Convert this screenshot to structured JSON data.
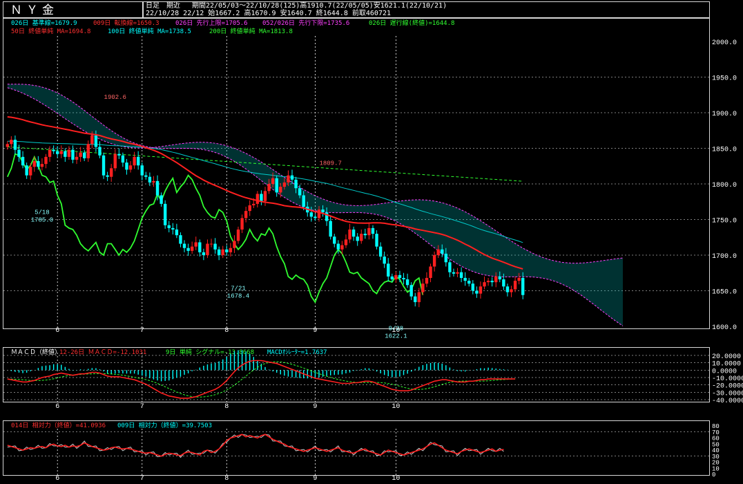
{
  "header": {
    "title": "ＮＹ金",
    "period_type": "日足　期近",
    "range_info": "期間22/05/03～22/10/28(125)高1910.7(22/05/05)安1621.1(22/10/21)",
    "ohlc_info": "22/10/28 22/12 始1667.2 高1670.9 安1640.7 終1644.8 前取460721"
  },
  "legend_line1": [
    {
      "text": "026日 基準線=1679.9",
      "color": "#00ffff"
    },
    {
      "text": "009日 転換線=1650.3",
      "color": "#ff3030"
    },
    {
      "text": "026日 先行上限=1705.6",
      "color": "#ff40ff"
    },
    {
      "text": "052/026日 先行下限=1735.6",
      "color": "#ff40ff"
    },
    {
      "text": "026日 遅行線(終値)=1644.8",
      "color": "#30ff30"
    }
  ],
  "legend_line2": [
    {
      "text": "50日 終値単純 MA=1694.8",
      "color": "#ff3030"
    },
    {
      "text": "100日 終値単純 MA=1738.5",
      "color": "#00ffff"
    },
    {
      "text": "200日 終値単純 MA=1813.8",
      "color": "#30ff30"
    }
  ],
  "macd_legend": [
    {
      "text": "ＭＡＣＤ（終値）",
      "color": "#ffffff"
    },
    {
      "text": "12-26日 ＭＡＣＤ=-12.1031",
      "color": "#ff3030"
    },
    {
      "text": "9日 単純 シグナル=-13.8668",
      "color": "#30ff30"
    },
    {
      "text": "MACDｵｼﾚｰﾀｰ=1.7637",
      "color": "#00ffff"
    }
  ],
  "rsi_legend": [
    {
      "text": "014日 相対力（終値）=41.0936",
      "color": "#ff3030"
    },
    {
      "text": "009日 相対力（終値）=39.7503",
      "color": "#00ffff"
    }
  ],
  "colors": {
    "up": "#ff2020",
    "down": "#00ffff",
    "ma50": "#ff2020",
    "ma100": "#00cccc",
    "ma200": "#30ff30",
    "chikou": "#30ff30",
    "kumo_a": "#ff40ff",
    "kumo_b": "#ff40ff",
    "kumo_fill": "#00c8c8",
    "grid": "#ffffff"
  },
  "chart_data": [
    {
      "type": "candlestick",
      "title": "ＮＹ金",
      "x_month_labels": [
        "6",
        "7",
        "8",
        "9",
        "10"
      ],
      "ylim": [
        1600,
        2000
      ],
      "y_ticks": [
        "2000.0",
        "1950.0",
        "1900.0",
        "1850.0",
        "1800.0",
        "1750.0",
        "1700.0",
        "1650.0",
        "1600.0"
      ],
      "annotations": [
        {
          "text": "5/18",
          "sub": "1785.0"
        },
        {
          "text": "7/21",
          "sub": "1678.4"
        },
        {
          "text": "9/28",
          "sub": "1622.1"
        },
        {
          "text": "1902.6"
        },
        {
          "text": "1809.7"
        }
      ],
      "close": [
        1856,
        1862,
        1848,
        1838,
        1826,
        1812,
        1824,
        1832,
        1824,
        1828,
        1838,
        1848,
        1846,
        1842,
        1846,
        1838,
        1848,
        1834,
        1838,
        1844,
        1836,
        1856,
        1868,
        1852,
        1840,
        1812,
        1810,
        1822,
        1842,
        1840,
        1830,
        1820,
        1826,
        1838,
        1826,
        1812,
        1810,
        1802,
        1804,
        1784,
        1772,
        1742,
        1738,
        1736,
        1728,
        1716,
        1710,
        1706,
        1712,
        1718,
        1704,
        1700,
        1716,
        1716,
        1708,
        1700,
        1708,
        1704,
        1710,
        1720,
        1736,
        1752,
        1762,
        1770,
        1772,
        1786,
        1776,
        1790,
        1800,
        1808,
        1788,
        1796,
        1802,
        1812,
        1806,
        1794,
        1784,
        1768,
        1760,
        1754,
        1752,
        1764,
        1760,
        1748,
        1726,
        1716,
        1708,
        1714,
        1722,
        1736,
        1726,
        1720,
        1730,
        1728,
        1738,
        1730,
        1712,
        1698,
        1688,
        1670,
        1666,
        1672,
        1668,
        1666,
        1658,
        1642,
        1634,
        1648,
        1660,
        1668,
        1684,
        1700,
        1708,
        1702,
        1690,
        1676,
        1674,
        1676,
        1668,
        1664,
        1660,
        1650,
        1646,
        1656,
        1662,
        1664,
        1662,
        1670,
        1666,
        1656,
        1648,
        1652,
        1664,
        1668,
        1644
      ],
      "macd": [
        -12,
        -13,
        -14,
        -15,
        -16,
        -16,
        -15,
        -14,
        -12,
        -10,
        -9,
        -8,
        -6,
        -5,
        -4,
        -5,
        -6,
        -7,
        -6,
        -5,
        -5,
        -4,
        -3,
        -3,
        -4,
        -6,
        -8,
        -9,
        -9,
        -9,
        -10,
        -11,
        -12,
        -13,
        -15,
        -17,
        -19,
        -22,
        -25,
        -28,
        -31,
        -33,
        -35,
        -36,
        -37,
        -38,
        -38,
        -38,
        -37,
        -36,
        -34,
        -32,
        -30,
        -28,
        -26,
        -23,
        -19,
        -14,
        -8,
        -2,
        3,
        7,
        10,
        12,
        13,
        13,
        13,
        12,
        11,
        10,
        9,
        7,
        5,
        3,
        1,
        -1,
        -3,
        -5,
        -7,
        -9,
        -11,
        -12,
        -13,
        -14,
        -15,
        -16,
        -17,
        -18,
        -18,
        -18,
        -17,
        -17,
        -16,
        -15,
        -15,
        -16,
        -18,
        -20,
        -22,
        -24,
        -26,
        -27,
        -28,
        -28,
        -28,
        -27,
        -25,
        -23,
        -21,
        -19,
        -17,
        -15,
        -14,
        -13,
        -13,
        -14,
        -15,
        -16,
        -16,
        -16,
        -15,
        -15,
        -14,
        -13,
        -13,
        -12,
        -12,
        -12,
        -12,
        -12,
        -12,
        -12,
        -12
      ],
      "rsi14": [
        48,
        46,
        44,
        42,
        40,
        42,
        44,
        43,
        45,
        46,
        44,
        48,
        50,
        47,
        46,
        48,
        45,
        47,
        46,
        48,
        52,
        49,
        46,
        44,
        42,
        40,
        41,
        44,
        45,
        43,
        42,
        43,
        42,
        40,
        38,
        36,
        35,
        36,
        34,
        32,
        30,
        33,
        35,
        34,
        32,
        31,
        35,
        37,
        36,
        34,
        32,
        38,
        40,
        36,
        38,
        42,
        48,
        56,
        60,
        62,
        64,
        66,
        62,
        64,
        62,
        60,
        64,
        66,
        62,
        58,
        55,
        52,
        50,
        46,
        44,
        42,
        40,
        38,
        40,
        42,
        44,
        42,
        40,
        38,
        40,
        42,
        44,
        40,
        38,
        36,
        35,
        38,
        40,
        42,
        38,
        36,
        34,
        32,
        36,
        40,
        38,
        36,
        34,
        32,
        34,
        36,
        38,
        40,
        42,
        46,
        50,
        52,
        48,
        44,
        40,
        38,
        36,
        34,
        38,
        40,
        42,
        40,
        38,
        36,
        38,
        40,
        42,
        38,
        40,
        41
      ]
    }
  ]
}
